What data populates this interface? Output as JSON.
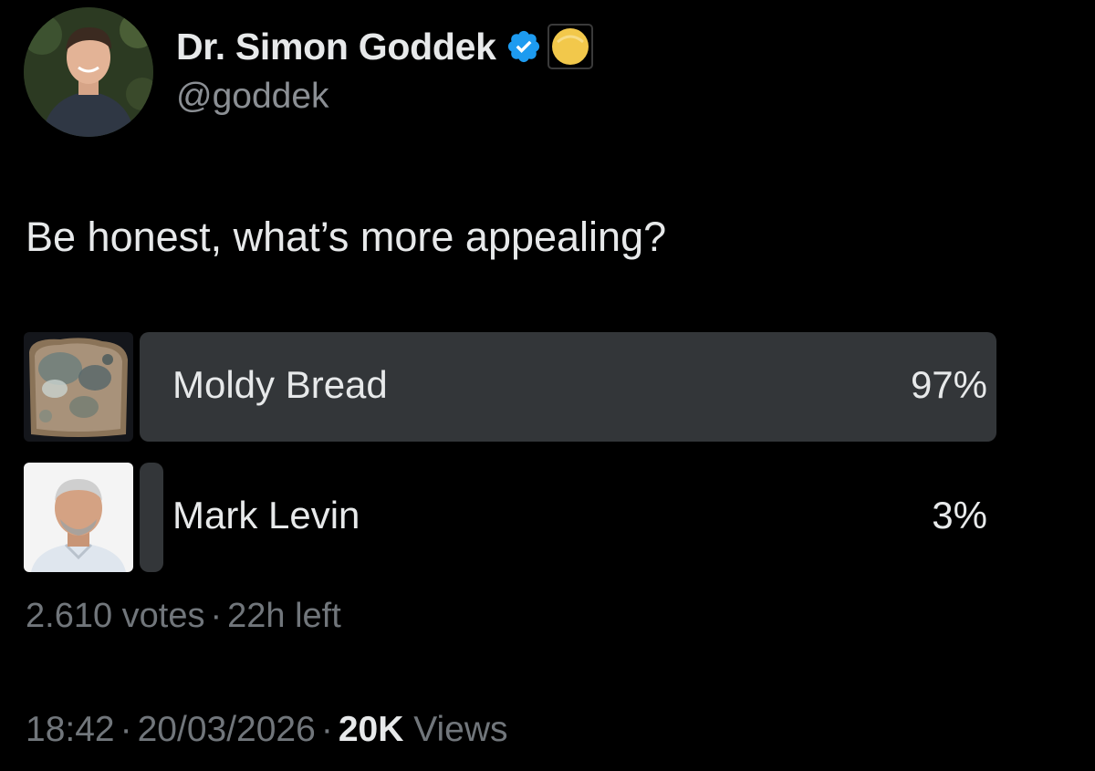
{
  "author": {
    "display_name": "Dr. Simon Goddek",
    "handle": "@goddek",
    "verified": true,
    "colors": {
      "verified_badge": "#1d9bf0",
      "affiliate_badge": "#f2c84b"
    }
  },
  "tweet": {
    "text": "Be honest, what’s more appealing?"
  },
  "poll": {
    "options": [
      {
        "label": "Moldy Bread",
        "percent_label": "97%",
        "percent": 97,
        "thumb": "moldy-bread-image"
      },
      {
        "label": "Mark Levin",
        "percent_label": "3%",
        "percent": 3,
        "thumb": "mark-levin-photo"
      }
    ],
    "votes": "2.610 votes",
    "separator": "·",
    "time_left": "22h left",
    "bar_color": "#333639"
  },
  "meta": {
    "time": "18:42",
    "date": "20/03/2026",
    "separator": "·",
    "views_count": "20K",
    "views_label": "Views"
  }
}
